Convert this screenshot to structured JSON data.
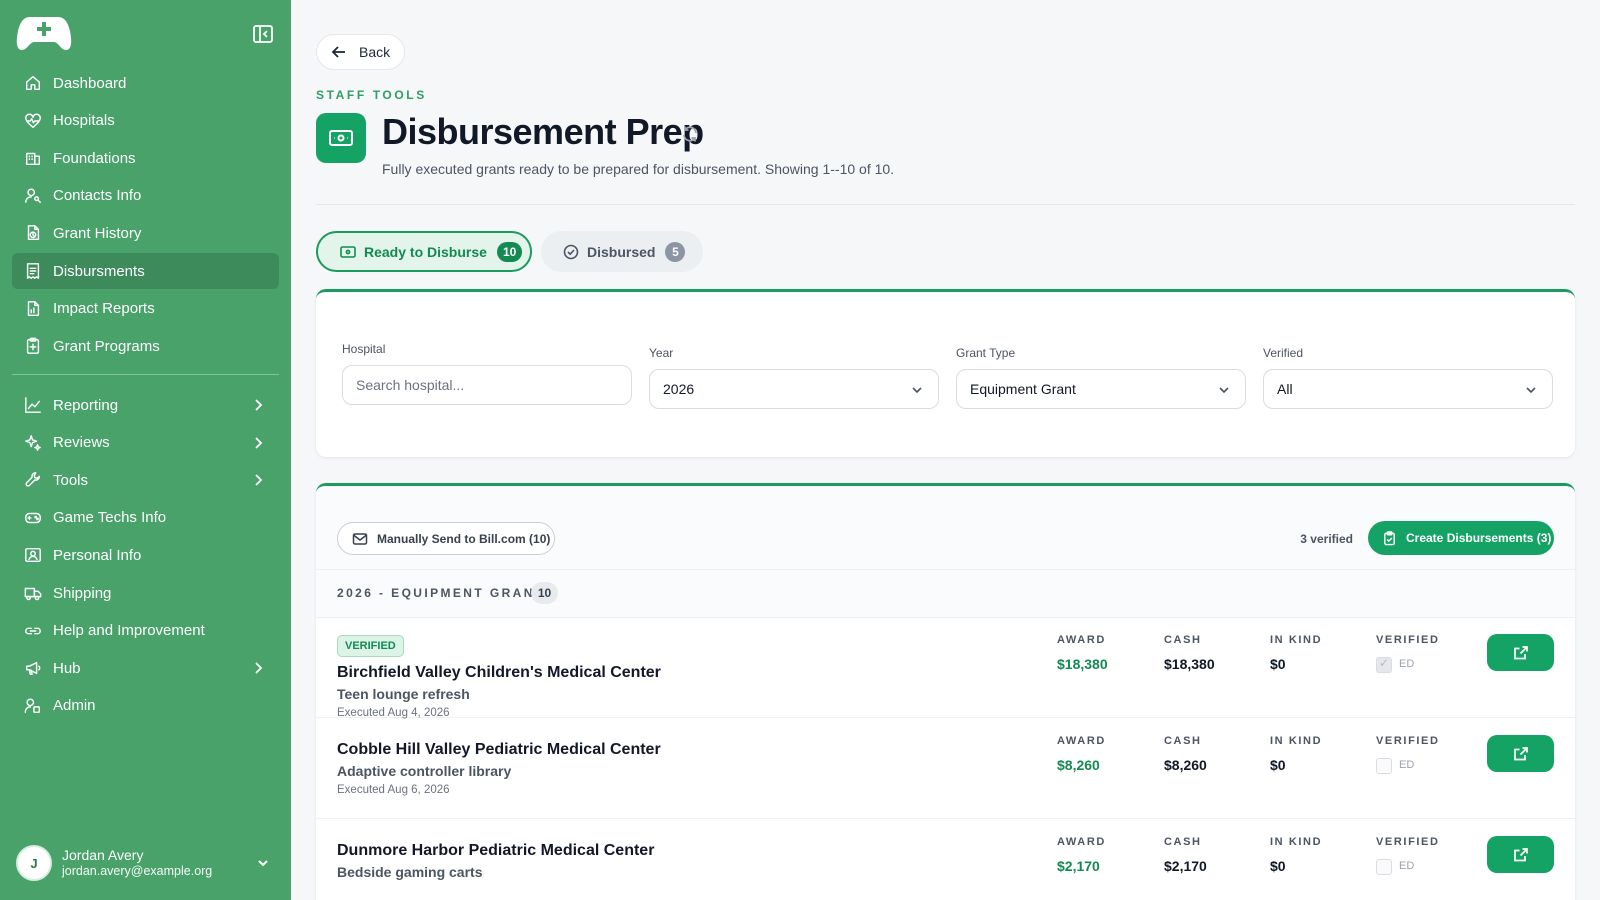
{
  "colors": {
    "sidebar": "#48a26a",
    "accent": "#14a365",
    "accent_text": "#138a52"
  },
  "sidebar": {
    "logo": "gamepad-plus-logo",
    "nav": [
      {
        "label": "Dashboard",
        "icon": "home-icon"
      },
      {
        "label": "Hospitals",
        "icon": "heart-pulse-icon"
      },
      {
        "label": "Foundations",
        "icon": "building-icon"
      },
      {
        "label": "Contacts Info",
        "icon": "user-key-icon"
      },
      {
        "label": "Grant History",
        "icon": "file-history-icon"
      },
      {
        "label": "Disbursments",
        "icon": "receipt-icon",
        "active": true
      },
      {
        "label": "Impact Reports",
        "icon": "file-chart-icon"
      },
      {
        "label": "Grant Programs",
        "icon": "clipboard-plus-icon"
      }
    ],
    "nav2": [
      {
        "label": "Reporting",
        "icon": "line-chart-icon",
        "expandable": true
      },
      {
        "label": "Reviews",
        "icon": "sparkles-icon",
        "expandable": true
      },
      {
        "label": "Tools",
        "icon": "wrench-icon",
        "expandable": true
      },
      {
        "label": "Game Techs Info",
        "icon": "gamepad-icon"
      },
      {
        "label": "Personal Info",
        "icon": "id-card-icon"
      },
      {
        "label": "Shipping",
        "icon": "truck-icon"
      },
      {
        "label": "Help and Improvement",
        "icon": "link-icon"
      },
      {
        "label": "Hub",
        "icon": "megaphone-icon",
        "expandable": true
      },
      {
        "label": "Admin",
        "icon": "user-cog-icon"
      }
    ],
    "user": {
      "initial": "J",
      "name": "Jordan Avery",
      "email": "jordan.avery@example.org"
    }
  },
  "header": {
    "back_label": "Back",
    "eyebrow": "STAFF TOOLS",
    "title": "Disbursement Prep",
    "subtitle": "Fully executed grants ready to be prepared for disbursement. Showing 1--10 of 10."
  },
  "tabs": [
    {
      "label": "Ready to Disburse",
      "count": "10",
      "active": true
    },
    {
      "label": "Disbursed",
      "count": "5"
    }
  ],
  "filters": {
    "hospital": {
      "label": "Hospital",
      "placeholder": "Search hospital..."
    },
    "year": {
      "label": "Year",
      "value": "2026"
    },
    "grant_type": {
      "label": "Grant Type",
      "value": "Equipment Grant"
    },
    "verified": {
      "label": "Verified",
      "value": "All"
    }
  },
  "toolbar": {
    "manual_label": "Manually Send to Bill.com (10)",
    "verified_count": "3 verified",
    "create_label": "Create Disbursements (3)"
  },
  "group": {
    "title": "2026 - EQUIPMENT GRANT",
    "count": "10"
  },
  "columns": {
    "award": "AWARD",
    "cash": "CASH",
    "in_kind": "IN KIND",
    "verified": "VERIFIED",
    "verified_box": "ED"
  },
  "rows": [
    {
      "badge": "VERIFIED",
      "hospital": "Birchfield Valley Children's Medical Center",
      "project": "Teen lounge refresh",
      "executed": "Executed Aug 4, 2026",
      "award": "$18,380",
      "cash": "$18,380",
      "in_kind": "$0",
      "verified": true
    },
    {
      "badge": "",
      "hospital": "Cobble Hill Valley Pediatric Medical Center",
      "project": "Adaptive controller library",
      "executed": "Executed Aug 6, 2026",
      "award": "$8,260",
      "cash": "$8,260",
      "in_kind": "$0",
      "verified": false
    },
    {
      "badge": "",
      "hospital": "Dunmore Harbor Pediatric Medical Center",
      "project": "Bedside gaming carts",
      "executed": "",
      "award": "$2,170",
      "cash": "$2,170",
      "in_kind": "$0",
      "verified": false
    }
  ]
}
